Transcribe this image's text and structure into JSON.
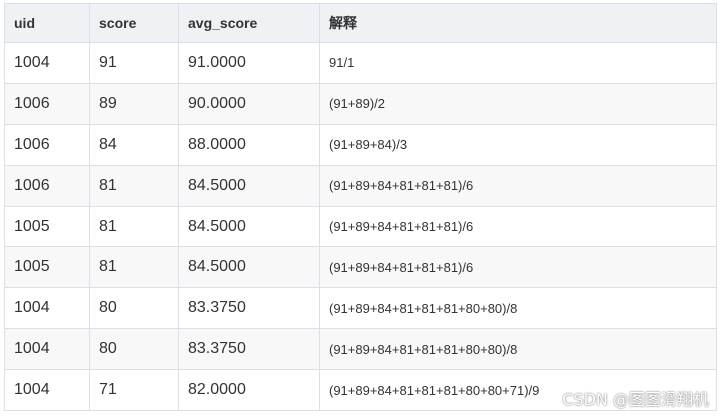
{
  "table": {
    "headers": [
      "uid",
      "score",
      "avg_score",
      "解释"
    ],
    "rows": [
      [
        "1004",
        "91",
        "91.0000",
        "91/1"
      ],
      [
        "1006",
        "89",
        "90.0000",
        "(91+89)/2"
      ],
      [
        "1006",
        "84",
        "88.0000",
        "(91+89+84)/3"
      ],
      [
        "1006",
        "81",
        "84.5000",
        "(91+89+84+81+81+81)/6"
      ],
      [
        "1005",
        "81",
        "84.5000",
        "(91+89+84+81+81+81)/6"
      ],
      [
        "1005",
        "81",
        "84.5000",
        "(91+89+84+81+81+81)/6"
      ],
      [
        "1004",
        "80",
        "83.3750",
        "(91+89+84+81+81+81+80+80)/8"
      ],
      [
        "1004",
        "80",
        "83.3750",
        "(91+89+84+81+81+81+80+80)/8"
      ],
      [
        "1004",
        "71",
        "82.0000",
        "(91+89+84+81+81+81+80+80+71)/9"
      ]
    ]
  },
  "watermark": "CSDN @图图滑翔机"
}
